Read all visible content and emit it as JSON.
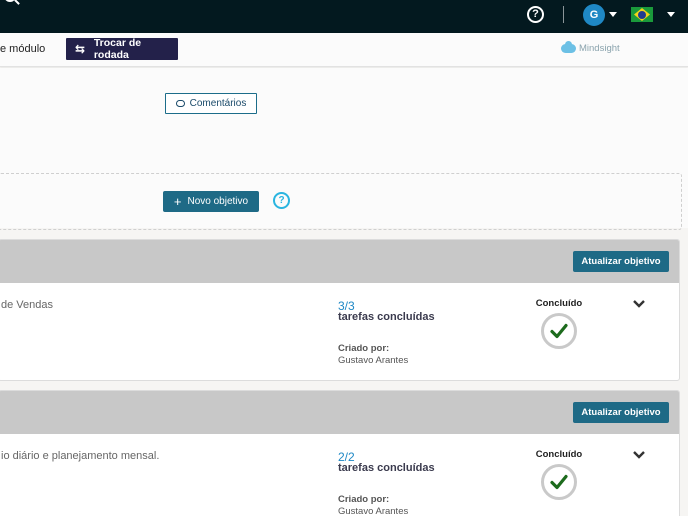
{
  "topbar": {
    "help_glyph": "?",
    "avatar_initial": "G",
    "locale": "pt-BR",
    "colors": {
      "bar_bg": "#03191f",
      "avatar": "#1f88c4"
    }
  },
  "subbar": {
    "module_text": "e módulo",
    "swap_label": "Trocar de rodada",
    "brand": "Mindsight"
  },
  "toolbar": {
    "comments_label": "Comentários",
    "new_objective_label": "Novo objetivo",
    "help_glyph": "?"
  },
  "objectives": [
    {
      "update_label": "Atualizar objetivo",
      "title": "de Vendas",
      "tasks_fraction": "3/3",
      "tasks_label": "tarefas concluídas",
      "created_label": "Criado por:",
      "creator": "Gustavo Arantes",
      "status": "Concluído"
    },
    {
      "update_label": "Atualizar objetivo",
      "title": "io diário e planejamento mensal.",
      "tasks_fraction": "2/2",
      "tasks_label": "tarefas concluídas",
      "created_label": "Criado por:",
      "creator": "Gustavo Arantes",
      "status": "Concluído"
    }
  ],
  "colors": {
    "primary_button": "#1e6a86",
    "swap_button": "#23214a",
    "success_check": "#1d6b1d",
    "link_blue": "#1e88c5"
  }
}
